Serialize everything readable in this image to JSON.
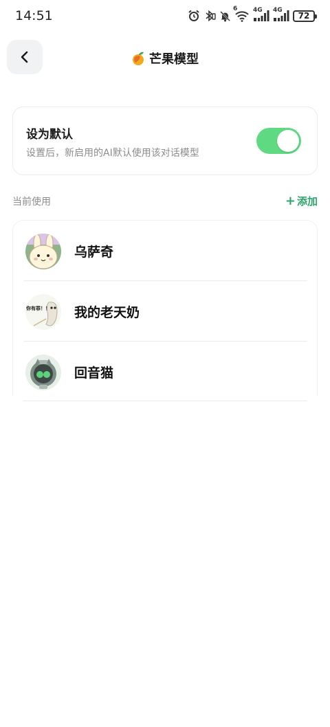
{
  "status_bar": {
    "time": "14:51",
    "battery": "72",
    "network_1": "4G",
    "network_2": "4G",
    "wifi_badge": "6"
  },
  "header": {
    "title": "芒果模型",
    "icon": "mango-icon"
  },
  "default_setting": {
    "title": "设为默认",
    "description": "设置后，新启用的AI默认使用该对话模型",
    "enabled": true,
    "accent_color": "#5fd982"
  },
  "section": {
    "label": "当前使用",
    "add_label": "添加",
    "add_color": "#2fa56b"
  },
  "models": [
    {
      "name": "乌萨奇",
      "avatar": "rabbit-avatar"
    },
    {
      "name": "我的老天奶",
      "avatar": "ghost-avatar",
      "avatar_text": "你有罪！！"
    },
    {
      "name": "回音猫",
      "avatar": "robot-cat-avatar"
    }
  ]
}
